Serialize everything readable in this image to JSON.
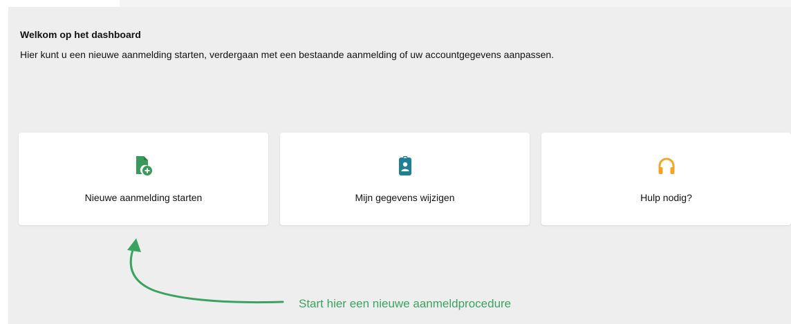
{
  "dashboard": {
    "heading": "Welkom op het dashboard",
    "intro": "Hier kunt u een nieuwe aanmelding starten, verdergaan met een bestaande aanmelding of uw accountgegevens aanpassen."
  },
  "cards": [
    {
      "label": "Nieuwe aanmelding starten",
      "icon": "file-add-icon",
      "icon_color": "#3a9a5b"
    },
    {
      "label": "Mijn gegevens wijzigen",
      "icon": "id-badge-icon",
      "icon_color": "#1f7f94"
    },
    {
      "label": "Hulp nodig?",
      "icon": "headphones-icon",
      "icon_color": "#f2a527"
    }
  ],
  "annotation": {
    "text": "Start hier een nieuwe aanmeldprocedure",
    "color": "#3aa35f"
  },
  "colors": {
    "background": "#eeeeee",
    "card": "#ffffff",
    "text": "#111111"
  }
}
